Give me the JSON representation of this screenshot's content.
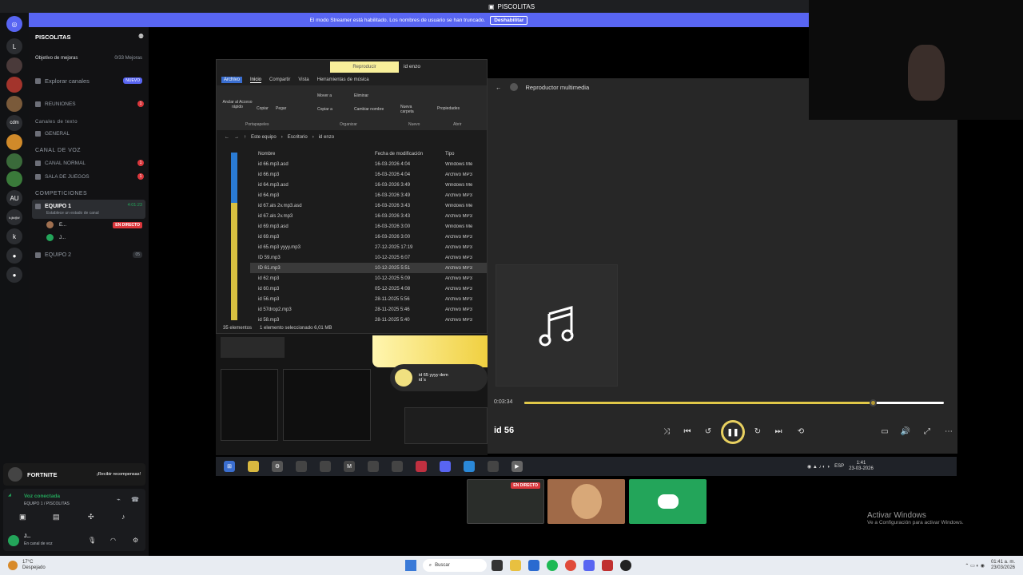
{
  "window_title": "PISCOLITAS",
  "streamer_banner": {
    "text": "El modo Streamer está habilitado. Los nombres de usuario se han truncado.",
    "button": "Deshabilitar"
  },
  "rail": [
    "L",
    "cdm",
    "AU",
    "k.jkl@#",
    "k"
  ],
  "server": {
    "name": "PISCOLITAS",
    "boost_label": "Objetivo de mejoras",
    "boost_count": "0/33 Mejoras",
    "explore": "Explorar canales",
    "explore_badge": "NUEVO",
    "meetings": "REUNIONES",
    "text_category": "Canales de texto",
    "general": "GENERAL",
    "voice_category": "CANAL DE VOZ",
    "voice_normal": "CANAL NORMAL",
    "voice_games": "SALA DE JUEGOS",
    "comp_category": "COMPETICIONES",
    "team1": "EQUIPO 1",
    "team1_time": "4:01:23",
    "team1_status": "Establece un estado de canal",
    "user1": "E...",
    "live_badge": "EN DIRECTO",
    "user2": "J...",
    "team2": "EQUIPO 2",
    "team2_count": "05"
  },
  "fortnite": {
    "title": "FORTNITE",
    "cta": "¡Recibir recompensas!"
  },
  "voice_panel": {
    "status": "Voz conectada",
    "channel": "EQUIPO 1 / PISCOLITAS",
    "user": "J...",
    "user_status": "En canal de voz"
  },
  "explorer": {
    "title": "id enzo",
    "highlight_tab": "Reproducir",
    "tabs": [
      "Archivo",
      "Inicio",
      "Compartir",
      "Vista",
      "Herramientas de música"
    ],
    "ribbon_groups": [
      "Portapapeles",
      "Organizar",
      "Nuevo",
      "Abrir"
    ],
    "ribbon_buttons": [
      "Anclar al Acceso rápido",
      "Copiar",
      "Pegar",
      "Mover a",
      "Copiar a",
      "Eliminar",
      "Cambiar nombre",
      "Nueva carpeta",
      "Propiedades"
    ],
    "path": [
      "Este equipo",
      "Escritorio",
      "id enzo"
    ],
    "columns": [
      "Nombre",
      "Fecha de modificación",
      "Tipo"
    ],
    "files": [
      {
        "name": "id 66.mp3.asd",
        "date": "16-03-2026 4:04",
        "type": "Windows Me"
      },
      {
        "name": "id 66.mp3",
        "date": "16-03-2026 4:04",
        "type": "Archivo MP3"
      },
      {
        "name": "id 64.mp3.asd",
        "date": "16-03-2026 3:49",
        "type": "Windows Me"
      },
      {
        "name": "id 64.mp3",
        "date": "16-03-2026 3:49",
        "type": "Archivo MP3"
      },
      {
        "name": "id 67.als 2v.mp3.asd",
        "date": "16-03-2026 3:43",
        "type": "Windows Me"
      },
      {
        "name": "id 67.als 2v.mp3",
        "date": "16-03-2026 3:43",
        "type": "Archivo MP3"
      },
      {
        "name": "id 69.mp3.asd",
        "date": "16-03-2026 3:00",
        "type": "Windows Me"
      },
      {
        "name": "id 69.mp3",
        "date": "16-03-2026 3:00",
        "type": "Archivo MP3"
      },
      {
        "name": "id 65.mp3 yyyy.mp3",
        "date": "27-12-2025 17:19",
        "type": "Archivo MP3"
      },
      {
        "name": "ID 59.mp3",
        "date": "10-12-2025 6:07",
        "type": "Archivo MP3"
      },
      {
        "name": "ID 61.mp3",
        "date": "10-12-2025 5:51",
        "type": "Archivo MP3"
      },
      {
        "name": "id 62.mp3",
        "date": "10-12-2025 5:09",
        "type": "Archivo MP3"
      },
      {
        "name": "id 60.mp3",
        "date": "05-12-2025 4:08",
        "type": "Archivo MP3"
      },
      {
        "name": "id 56.mp3",
        "date": "28-11-2025 5:56",
        "type": "Archivo MP3"
      },
      {
        "name": "id 57drop2.mp3",
        "date": "28-11-2025 5:46",
        "type": "Archivo MP3"
      },
      {
        "name": "id 58.mp3",
        "date": "28-11-2025 5:40",
        "type": "Archivo MP3"
      }
    ],
    "status": [
      "35 elementos",
      "1 elemento seleccionado 6,01 MB"
    ]
  },
  "player": {
    "title": "Reproductor multimedia",
    "elapsed": "0:03:34",
    "progress": 0.83,
    "track": "id 56"
  },
  "notification": {
    "title": "id 65 yyyy dem",
    "sub": "id`s"
  },
  "inner_tray": {
    "lang": "ESP",
    "time": "1:41",
    "date": "23-03-2026"
  },
  "tiles": {
    "live": "EN DIRECTO"
  },
  "activate": {
    "title": "Activar Windows",
    "sub": "Ve a Configuración para activar Windows."
  },
  "win_taskbar": {
    "weather": "17°C",
    "weather_sub": "Despejado",
    "search": "Buscar",
    "time": "01:41 a. m.",
    "date": "23/03/2026"
  },
  "colors": {
    "blurple": "#5865f2",
    "live_red": "#da373c",
    "accent_yellow": "#e0c848"
  }
}
